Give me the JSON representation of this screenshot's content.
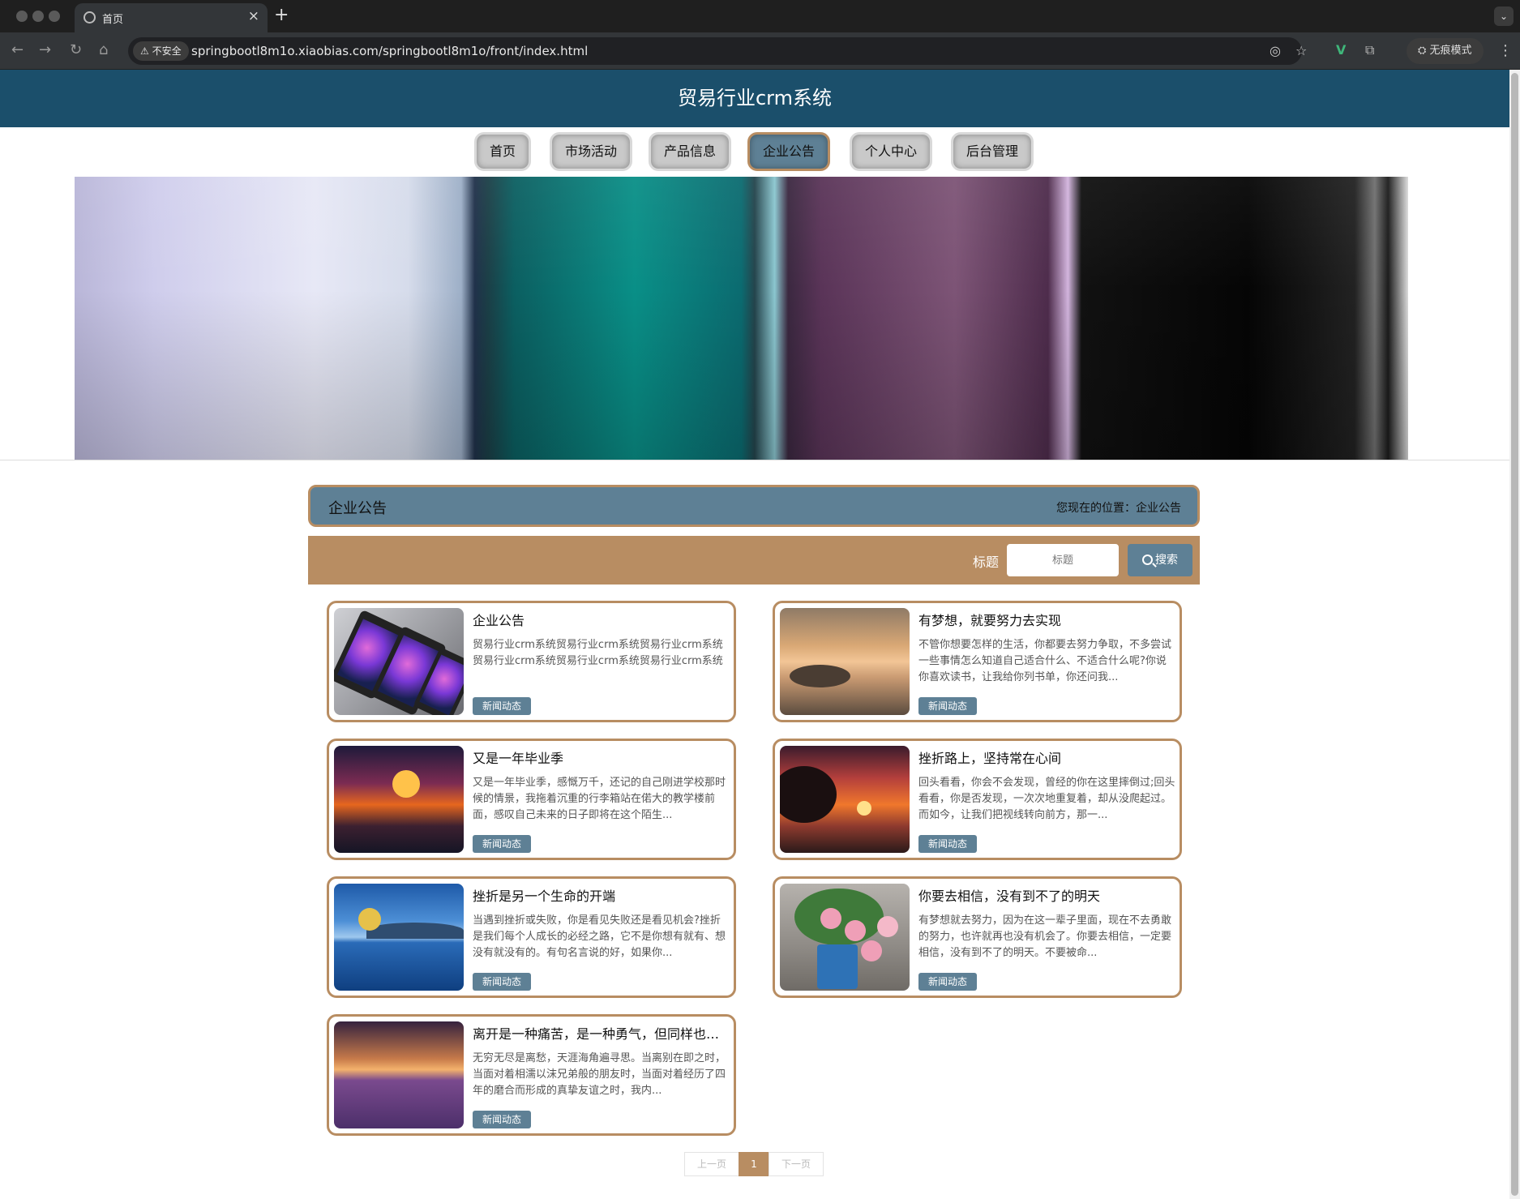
{
  "browser": {
    "tab_title": "首页",
    "tab_close": "×",
    "new_tab": "+",
    "tab_menu": "⌄",
    "insecure_label": "⚠ 不安全",
    "url": "springbootl8m1o.xiaobias.com/springbootl8m1o/front/index.html",
    "incognito_label": "无痕模式",
    "icons": {
      "back": "←",
      "forward": "→",
      "reload": "↻",
      "home": "⌂",
      "eye_off": "◎",
      "star": "☆",
      "ext_v": "V",
      "puzzle": "⧉",
      "kebab": "⋮",
      "incognito": "⛭"
    }
  },
  "site": {
    "title": "贸易行业crm系统"
  },
  "nav": {
    "items": [
      {
        "label": "首页",
        "active": false
      },
      {
        "label": "市场活动",
        "active": false
      },
      {
        "label": "产品信息",
        "active": false
      },
      {
        "label": "企业公告",
        "active": true
      },
      {
        "label": "个人中心",
        "active": false
      },
      {
        "label": "后台管理",
        "active": false
      }
    ]
  },
  "section": {
    "title": "企业公告",
    "breadcrumb": "您现在的位置：企业公告"
  },
  "search": {
    "label": "标题",
    "placeholder": "标题",
    "button_label": "搜索"
  },
  "news": [
    {
      "title": "企业公告",
      "desc": "贸易行业crm系统贸易行业crm系统贸易行业crm系统贸易行业crm系统贸易行业crm系统贸易行业crm系统",
      "tag": "新闻动态"
    },
    {
      "title": "有梦想，就要努力去实现",
      "desc": "不管你想要怎样的生活，你都要去努力争取，不多尝试一些事情怎么知道自己适合什么、不适合什么呢?你说你喜欢读书，让我给你列书单，你还问我...",
      "tag": "新闻动态"
    },
    {
      "title": "又是一年毕业季",
      "desc": "又是一年毕业季，感慨万千，还记的自己刚进学校那时候的情景，我拖着沉重的行李箱站在偌大的教学楼前面，感叹自己未来的日子即将在这个陌生...",
      "tag": "新闻动态"
    },
    {
      "title": "挫折路上，坚持常在心间",
      "desc": "回头看看，你会不会发现，曾经的你在这里摔倒过;回头看看，你是否发现，一次次地重复着，却从没爬起过。而如今，让我们把视线转向前方，那一...",
      "tag": "新闻动态"
    },
    {
      "title": "挫折是另一个生命的开端",
      "desc": "当遇到挫折或失败，你是看见失败还是看见机会?挫折是我们每个人成长的必经之路，它不是你想有就有、想没有就没有的。有句名言说的好，如果你...",
      "tag": "新闻动态"
    },
    {
      "title": "你要去相信，没有到不了的明天",
      "desc": "有梦想就去努力，因为在这一辈子里面，现在不去勇敢的努力，也许就再也没有机会了。你要去相信，一定要相信，没有到不了的明天。不要被命...",
      "tag": "新闻动态"
    },
    {
      "title": "离开是一种痛苦，是一种勇气，但同样也是一种无奈",
      "desc": "无穷无尽是离愁，天涯海角遍寻思。当离别在即之时，当面对着相濡以沫兄弟般的朋友时，当面对着经历了四年的磨合而形成的真挚友谊之时，我内...",
      "tag": "新闻动态"
    }
  ],
  "pagination": {
    "prev": "上一页",
    "current": "1",
    "next": "下一页"
  }
}
